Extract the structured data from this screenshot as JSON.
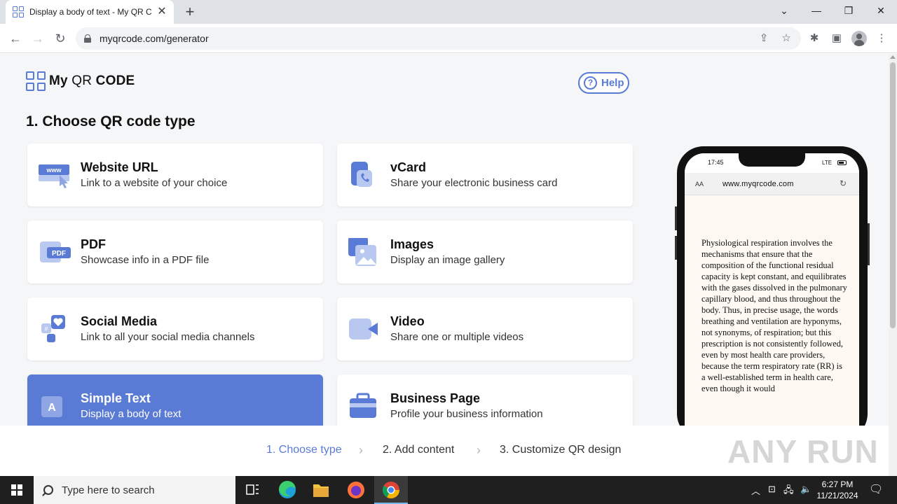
{
  "browser": {
    "tab_title": "Display a body of text - My QR C",
    "url": "myqrcode.com/generator",
    "window_controls": {
      "minimize": "—",
      "restore": "❐",
      "close": "✕",
      "tab_search": "⌄"
    }
  },
  "header": {
    "logo_my": "My",
    "logo_qr": "QR",
    "logo_code": "CODE",
    "help_label": "Help"
  },
  "main": {
    "heading": "1. Choose QR code type",
    "cards": [
      {
        "title": "Website URL",
        "desc": "Link to a website of your choice"
      },
      {
        "title": "vCard",
        "desc": "Share your electronic business card"
      },
      {
        "title": "PDF",
        "desc": "Showcase info in a PDF file"
      },
      {
        "title": "Images",
        "desc": "Display an image gallery"
      },
      {
        "title": "Social Media",
        "desc": "Link to all your social media channels"
      },
      {
        "title": "Video",
        "desc": "Share one or multiple videos"
      },
      {
        "title": "Simple Text",
        "desc": "Display a body of text"
      },
      {
        "title": "Business Page",
        "desc": "Profile your business information"
      }
    ],
    "selected_card": "Simple Text",
    "icon_labels": {
      "www": "www",
      "pdf": "PDF",
      "text": "A"
    }
  },
  "preview": {
    "time": "17:45",
    "network": "LTE",
    "text_size": "AA",
    "url": "www.myqrcode.com",
    "body_text": "Physiological respiration involves the mechanisms that ensure that the composition of the functional residual capacity is kept constant, and equilibrates with the gases dissolved in the pulmonary capillary blood, and thus throughout the body. Thus, in precise usage, the words breathing and ventilation are hyponyms, not synonyms, of respiration; but this prescription is not consistently followed, even by most health care providers, because the term respiratory rate (RR) is a well-established term in health care, even though it would"
  },
  "steps": {
    "items": [
      "1. Choose type",
      "2. Add content",
      "3. Customize QR design"
    ],
    "current": 0,
    "watermark": "ANY RUN"
  },
  "taskbar": {
    "search_placeholder": "Type here to search",
    "time": "6:27 PM",
    "date": "11/21/2024"
  },
  "colors": {
    "accent": "#5a7bd5",
    "page_bg": "#f5f6f8",
    "icon_light": "#b9c8f0"
  }
}
